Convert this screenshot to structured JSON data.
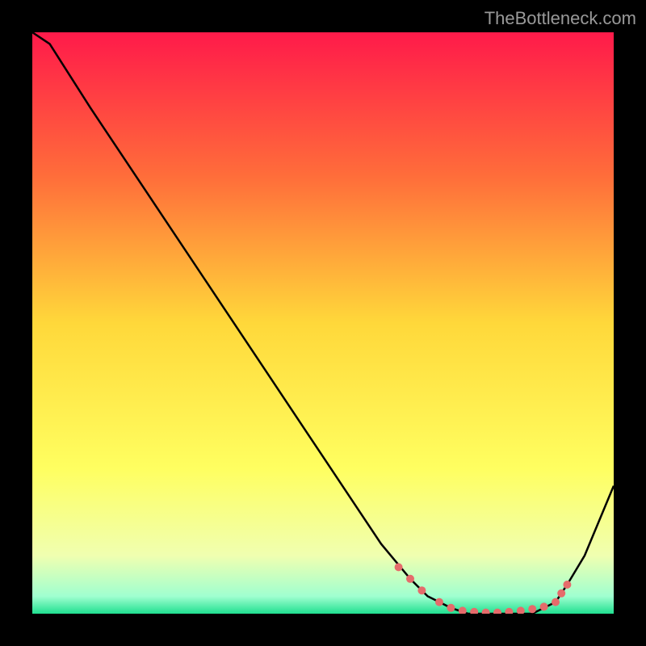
{
  "watermark": "TheBottleneck.com",
  "chart_data": {
    "type": "line",
    "title": "",
    "xlabel": "",
    "ylabel": "",
    "xlim": [
      0,
      100
    ],
    "ylim": [
      0,
      100
    ],
    "x": [
      0,
      3,
      10,
      20,
      30,
      40,
      50,
      60,
      65,
      68,
      72,
      75,
      78,
      80,
      82,
      84,
      86,
      88,
      90,
      92,
      95,
      100
    ],
    "values": [
      100,
      98,
      87,
      72,
      57,
      42,
      27,
      12,
      6,
      3,
      1,
      0,
      0,
      0,
      0,
      0,
      0,
      1,
      2,
      5,
      10,
      22
    ],
    "gradient_stops": [
      {
        "offset": 0.0,
        "color": "#ff1a4a"
      },
      {
        "offset": 0.25,
        "color": "#ff6e3a"
      },
      {
        "offset": 0.5,
        "color": "#ffd83a"
      },
      {
        "offset": 0.75,
        "color": "#ffff60"
      },
      {
        "offset": 0.9,
        "color": "#f0ffb0"
      },
      {
        "offset": 0.97,
        "color": "#a0ffd0"
      },
      {
        "offset": 1.0,
        "color": "#20e090"
      }
    ],
    "markers": {
      "x": [
        63,
        65,
        67,
        70,
        72,
        74,
        76,
        78,
        80,
        82,
        84,
        86,
        88,
        90,
        91,
        92
      ],
      "y": [
        8,
        6,
        4,
        2,
        1,
        0.5,
        0.3,
        0.2,
        0.2,
        0.3,
        0.5,
        0.8,
        1.2,
        2,
        3.5,
        5
      ],
      "color": "#e56b6b"
    }
  }
}
